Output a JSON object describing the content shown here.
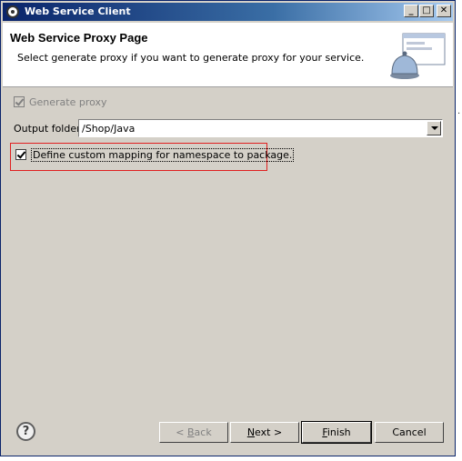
{
  "window": {
    "title": "Web Service Client",
    "controls": {
      "minimize": "_",
      "maximize": "□",
      "close": "✕"
    }
  },
  "banner": {
    "title": "Web Service Proxy Page",
    "description": "Select generate proxy if you want to generate proxy for your service.",
    "icon": "service-bell-icon"
  },
  "options": {
    "generate_proxy": {
      "label": "Generate proxy",
      "checked": true,
      "enabled": false
    },
    "output_folder": {
      "label": "Output folder",
      "value": "/Shop/Java"
    },
    "custom_mapping": {
      "label": "Define custom mapping for namespace to package.",
      "checked": true
    }
  },
  "buttons": {
    "help": "?",
    "back": {
      "prefix": "< ",
      "mnemonic": "B",
      "rest": "ack"
    },
    "next": {
      "mnemonic": "N",
      "rest": "ext >"
    },
    "finish": {
      "mnemonic": "F",
      "rest": "inish"
    },
    "cancel": "Cancel"
  },
  "colors": {
    "dialog_bg": "#d4d0c8",
    "title_bar": "#0a246a",
    "highlight": "#e02020"
  }
}
